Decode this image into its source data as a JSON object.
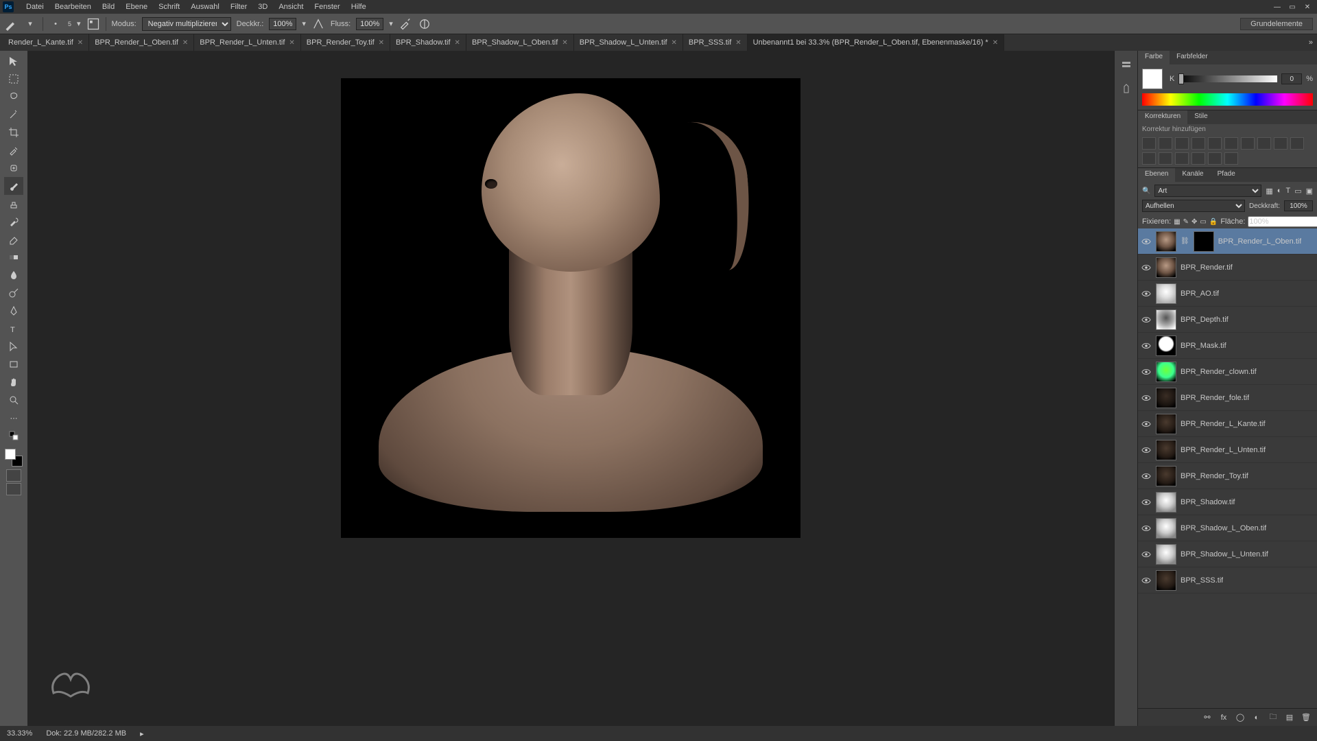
{
  "app": {
    "name": "Ps"
  },
  "menu": [
    "Datei",
    "Bearbeiten",
    "Bild",
    "Ebene",
    "Schrift",
    "Auswahl",
    "Filter",
    "3D",
    "Ansicht",
    "Fenster",
    "Hilfe"
  ],
  "options": {
    "brush_size": "5",
    "mode_label": "Modus:",
    "mode_value": "Negativ multiplizieren",
    "opacity_label": "Deckkr.:",
    "opacity_value": "100%",
    "flow_label": "Fluss:",
    "flow_value": "100%",
    "workspace": "Grundelemente"
  },
  "tabs": [
    {
      "label": "Render_L_Kante.tif",
      "active": false
    },
    {
      "label": "BPR_Render_L_Oben.tif",
      "active": false
    },
    {
      "label": "BPR_Render_L_Unten.tif",
      "active": false
    },
    {
      "label": "BPR_Render_Toy.tif",
      "active": false
    },
    {
      "label": "BPR_Shadow.tif",
      "active": false
    },
    {
      "label": "BPR_Shadow_L_Oben.tif",
      "active": false
    },
    {
      "label": "BPR_Shadow_L_Unten.tif",
      "active": false
    },
    {
      "label": "BPR_SSS.tif",
      "active": false
    },
    {
      "label": "Unbenannt1 bei 33.3% (BPR_Render_L_Oben.tif, Ebenenmaske/16) *",
      "active": true
    }
  ],
  "color_panel": {
    "tabs": [
      "Farbe",
      "Farbfelder"
    ],
    "channel": "K",
    "value": "0",
    "unit": "%"
  },
  "adjustments_panel": {
    "tabs": [
      "Korrekturen",
      "Stile"
    ],
    "hint": "Korrektur hinzufügen"
  },
  "layers_panel": {
    "tabs": [
      "Ebenen",
      "Kanäle",
      "Pfade"
    ],
    "filter_label": "Art",
    "blend_mode": "Aufhellen",
    "opacity_label": "Deckkraft:",
    "opacity_value": "100%",
    "lock_label": "Fixieren:",
    "fill_label": "Fläche:",
    "fill_value": "100%",
    "layers": [
      {
        "name": "BPR_Render_L_Oben.tif",
        "thumb": "th-render",
        "mask": true,
        "selected": true
      },
      {
        "name": "BPR_Render.tif",
        "thumb": "th-render"
      },
      {
        "name": "BPR_AO.tif",
        "thumb": "th-ao"
      },
      {
        "name": "BPR_Depth.tif",
        "thumb": "th-depth"
      },
      {
        "name": "BPR_Mask.tif",
        "thumb": "th-mask"
      },
      {
        "name": "BPR_Render_clown.tif",
        "thumb": "th-clown"
      },
      {
        "name": "BPR_Render_fole.tif",
        "thumb": "th-fole"
      },
      {
        "name": "BPR_Render_L_Kante.tif",
        "thumb": "th-dark"
      },
      {
        "name": "BPR_Render_L_Unten.tif",
        "thumb": "th-dark"
      },
      {
        "name": "BPR_Render_Toy.tif",
        "thumb": "th-dark"
      },
      {
        "name": "BPR_Shadow.tif",
        "thumb": "th-shadow"
      },
      {
        "name": "BPR_Shadow_L_Oben.tif",
        "thumb": "th-shadow"
      },
      {
        "name": "BPR_Shadow_L_Unten.tif",
        "thumb": "th-shadow"
      },
      {
        "name": "BPR_SSS.tif",
        "thumb": "th-dark"
      }
    ]
  },
  "status": {
    "zoom": "33.33%",
    "doc": "Dok: 22.9 MB/282.2 MB"
  }
}
